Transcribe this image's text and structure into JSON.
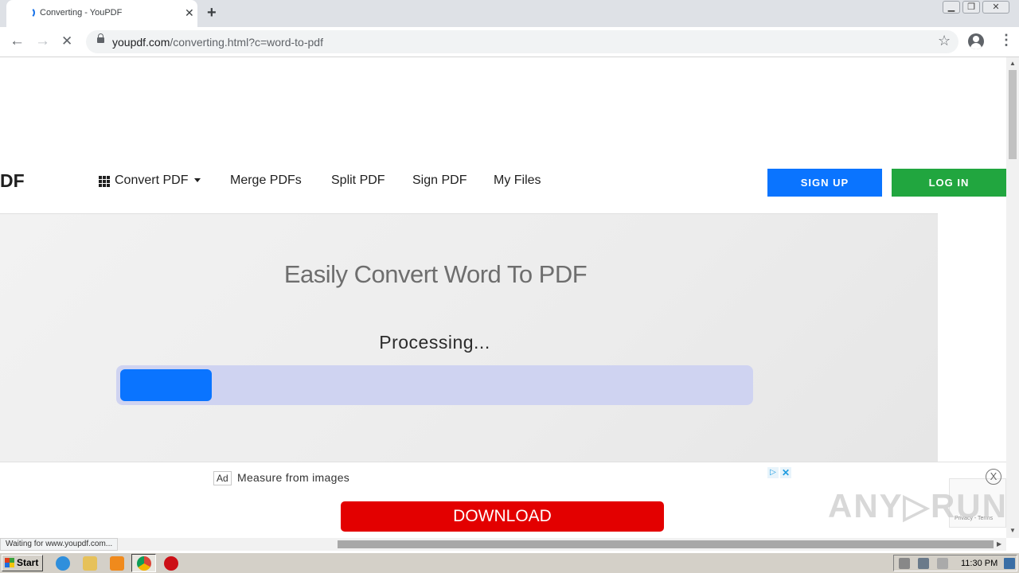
{
  "browser": {
    "tab_title": "Converting - YouPDF",
    "tab_close": "✕",
    "new_tab": "+",
    "url_host": "youpdf.com",
    "url_path": "/converting.html?c=word-to-pdf",
    "window_controls": {
      "minimize": "▁",
      "restore": "❐",
      "close": "✕"
    }
  },
  "site": {
    "logo_text": "DF",
    "nav": {
      "convert": "Convert PDF",
      "merge": "Merge PDFs",
      "split": "Split PDF",
      "sign": "Sign PDF",
      "files": "My Files"
    },
    "signup_label": "SIGN UP",
    "login_label": "LOG IN",
    "hero_title": "Easily Convert Word To PDF",
    "processing_text": "Processing...",
    "progress_fraction": 0.145
  },
  "ad": {
    "badge": "Ad",
    "text": "Measure from images",
    "info": "▷",
    "close": "✕",
    "download_label": "DOWNLOAD",
    "overlay_close": "X"
  },
  "watermark": "ANY▷RUN",
  "recaptcha_text": "Privacy - Terms",
  "status_text": "Waiting for www.youpdf.com...",
  "taskbar": {
    "start_label": "Start",
    "clock": "11:30 PM"
  },
  "colors": {
    "signup": "#0a74ff",
    "login": "#21a63f",
    "download": "#e30000",
    "progress_fill": "#0a74ff",
    "progress_track": "#cfd3f1"
  }
}
